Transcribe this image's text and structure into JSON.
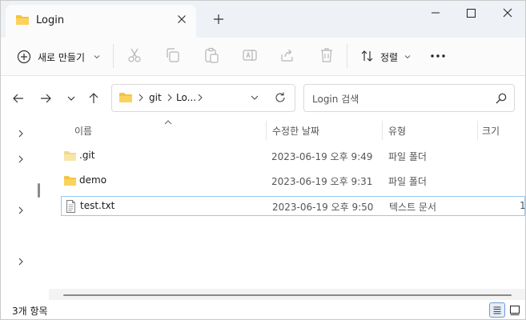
{
  "window": {
    "tab_title": "Login"
  },
  "toolbar": {
    "new_label": "새로 만들기",
    "sort_label": "정렬",
    "icons": [
      "cut-icon",
      "copy-icon",
      "paste-icon",
      "rename-icon",
      "share-icon",
      "delete-icon"
    ]
  },
  "address": {
    "crumbs": [
      "git",
      "Lo..."
    ]
  },
  "search": {
    "placeholder": "Login 검색"
  },
  "columns": {
    "name": "이름",
    "modified": "수정한 날짜",
    "type": "유형",
    "size": "크기"
  },
  "files": [
    {
      "name": ".git",
      "modified": "2023-06-19 오후 9:49",
      "type": "파일 폴더",
      "size": "",
      "kind": "folder"
    },
    {
      "name": "demo",
      "modified": "2023-06-19 오후 9:31",
      "type": "파일 폴더",
      "size": "",
      "kind": "folder"
    },
    {
      "name": "test.txt",
      "modified": "2023-06-19 오후 9:50",
      "type": "텍스트 문서",
      "size": "1",
      "kind": "text"
    }
  ],
  "status": {
    "item_count": "3개 항목"
  },
  "colors": {
    "folder": "#f5c342",
    "selection_border": "#99c7ee",
    "accent": "#2b6cc4"
  }
}
